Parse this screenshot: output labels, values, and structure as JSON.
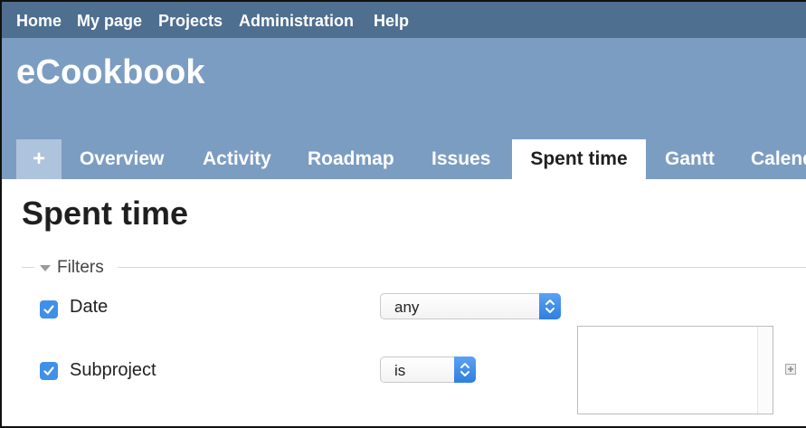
{
  "top_menu": {
    "home": "Home",
    "my_page": "My page",
    "projects": "Projects",
    "administration": "Administration",
    "help": "Help"
  },
  "header": {
    "title": "eCookbook"
  },
  "tabs": {
    "new": "+",
    "overview": "Overview",
    "activity": "Activity",
    "roadmap": "Roadmap",
    "issues": "Issues",
    "spent_time": "Spent time",
    "gantt": "Gantt",
    "calendar": "Calendar"
  },
  "main": {
    "title": "Spent time"
  },
  "filters": {
    "legend": "Filters",
    "date": {
      "label": "Date",
      "checked": true,
      "operator": "any"
    },
    "subproject": {
      "label": "Subproject",
      "checked": true,
      "operator": "is"
    }
  },
  "colors": {
    "top_menu_bg": "#4e6f8f",
    "header_bg": "#7c9dc2",
    "active_tab_bg": "#ffffff",
    "checkbox_accent": "#3f90e8"
  },
  "icons": {
    "filters_toggle": "triangle-down-icon",
    "checkbox": "check-icon",
    "select_stepper": "up-down-chevron-icon",
    "multi_select_toggle": "plus-icon"
  }
}
